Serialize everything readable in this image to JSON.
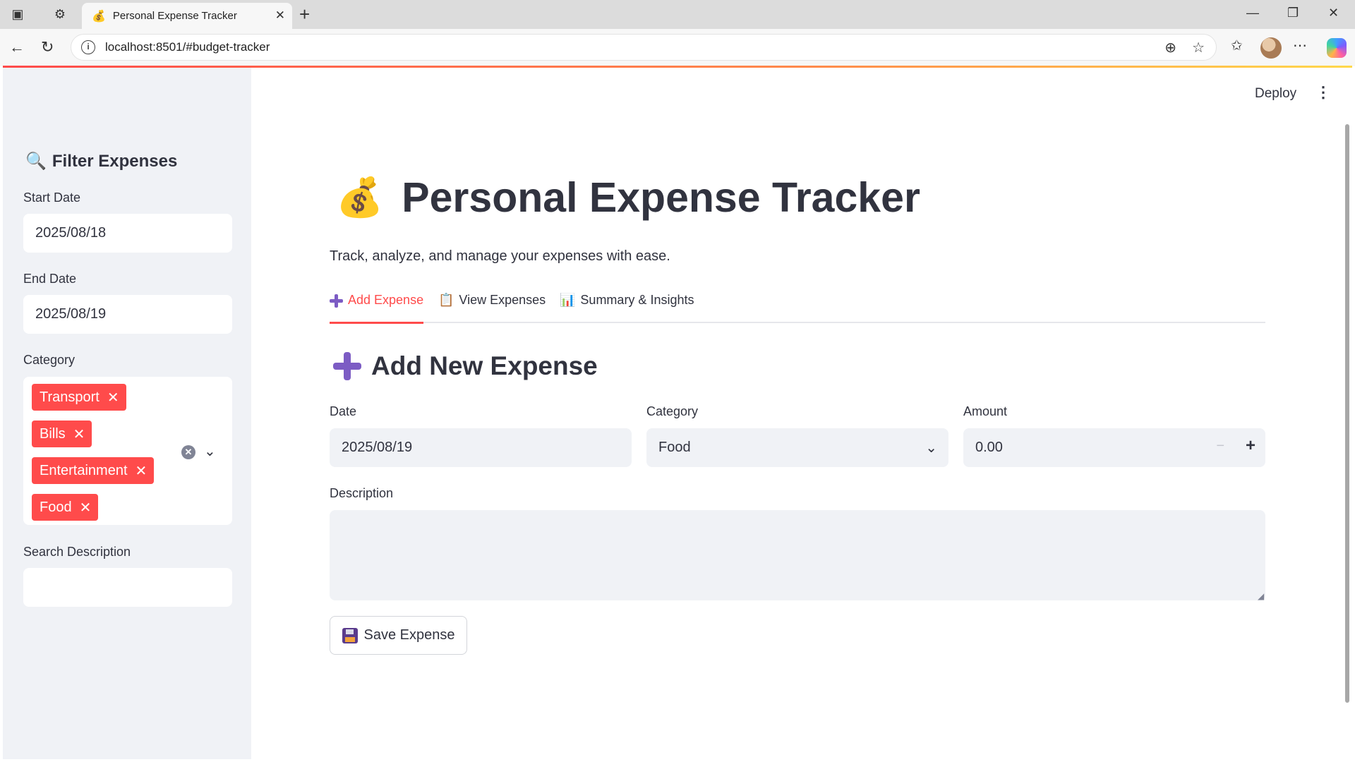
{
  "browser": {
    "tab_title": "Personal Expense Tracker",
    "tab_favicon": "💰",
    "url": "localhost:8501/#budget-tracker"
  },
  "sidebar": {
    "header_icon": "🔍",
    "header": "Filter Expenses",
    "start_date_label": "Start Date",
    "start_date_value": "2025/08/18",
    "end_date_label": "End Date",
    "end_date_value": "2025/08/19",
    "category_label": "Category",
    "categories": [
      "Transport",
      "Bills",
      "Entertainment",
      "Food"
    ],
    "search_label": "Search Description",
    "search_value": ""
  },
  "header": {
    "deploy_label": "Deploy"
  },
  "main": {
    "title_icon": "💰",
    "title": "Personal Expense Tracker",
    "subtitle": "Track, analyze, and manage your expenses with ease.",
    "tabs": [
      {
        "icon": "plus-icon",
        "label": "Add Expense",
        "active": true
      },
      {
        "icon": "📋",
        "label": "View Expenses",
        "active": false
      },
      {
        "icon": "📊",
        "label": "Summary & Insights",
        "active": false
      }
    ],
    "section_title": "Add New Expense",
    "form": {
      "date_label": "Date",
      "date_value": "2025/08/19",
      "category_label": "Category",
      "category_value": "Food",
      "amount_label": "Amount",
      "amount_value": "0.00",
      "description_label": "Description",
      "description_value": "",
      "save_label": "Save Expense"
    }
  },
  "colors": {
    "accent": "#ff4b4b",
    "sidebar_bg": "#f0f2f6",
    "text": "#31333f",
    "plus": "#7c5cc4"
  }
}
